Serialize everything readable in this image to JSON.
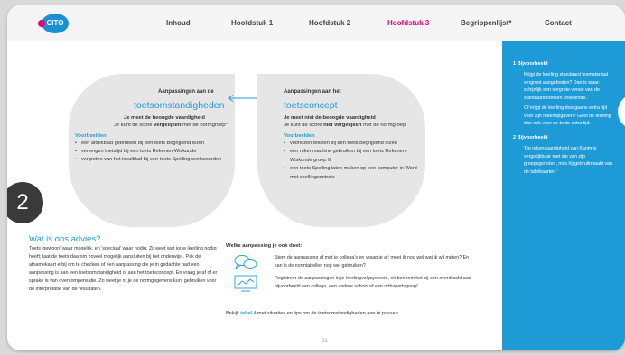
{
  "nav": {
    "logo": "CITO",
    "items": [
      "Inhoud",
      "Hoofdstuk 1",
      "Hoofdstuk 2",
      "Hoofdstuk 3",
      "Begrippenlijst*",
      "Contact"
    ],
    "active": "Hoofdstuk 3",
    "colors": {
      "active": "#e6007e",
      "accent": "#1e9bd7"
    }
  },
  "left_blob": {
    "title": "Aanpassingen aan de",
    "big": "toetsomstandigheden",
    "bold": "Je meet de beoogde vaardigheid",
    "norm_pre": "Je kunt de score ",
    "norm_bold": "vergelijken",
    "norm_post": " met de normgroep*",
    "examples_title": "Voorbeelden",
    "examples": [
      "een afdekblad gebruiken bij een toets Begrijpend lezen",
      "verlengen toetstijd bij een toets Rekenen-Wiskunde",
      "vergroten van het invulblad bij een toets Spelling werkwoorden"
    ]
  },
  "right_blob": {
    "title": "Aanpassingen aan het",
    "big": "toetsconcept",
    "bold": "Je meet niet de beoogde vaardigheid",
    "norm_pre": "Je kunt de score ",
    "norm_bold": "niet vergelijken",
    "norm_post": " met de normgroep",
    "examples_title": "Voorbeelden",
    "examples": [
      "voorlezen teksten bij een toets Begrijpend lezen",
      "een rekenmachine gebruiken bij een toets Rekenen-Wiskunde groep 6",
      "een toets Spelling laten maken op een computer in Word met spellingcontrole"
    ]
  },
  "section_number": "2",
  "advice": {
    "title": "Wat is ons advies?",
    "text": "Toets 'gewoon' waar mogelijk, en 'speciaal' waar nodig. Zij weet wat jouw leerling nodig heeft; laat de toets daarom zoveel mogelijk aansluiten bij het onderwijs¹. Pak de afnamekaart erbij om te checken of een aanpassing die je in gedachte had een aanpassing is aan een toetsomstandigheid of aan het toetsconcept. En vraag je af of er sprake is van overcompensatie. Zo weet je of je de normgegevens kunt gebruiken voor de interpretatie van de resultaten."
  },
  "what_to_do": {
    "title": "Welke aanpassing je ook doet:",
    "items": [
      {
        "icon": "chat-bubbles-icon",
        "text": "Stem de aanpassing af met je collega's en vraag je af: meet ik nog wel wat ik wil meten? En kan ik de normtabellen nog wel gebruiken?"
      },
      {
        "icon": "computer-screen-icon",
        "text": "Registreer de aanpassingen in je leerlingvolgsysteem, en benoem het bij een overdracht aan bijvoorbeeld een collega, een andere school of een orthopedagoog²."
      }
    ],
    "bekijk_pre": "Bekijk ",
    "bekijk_link": "tabel 4",
    "bekijk_post": " met situaties en tips om de toetsomstandigheden aan te passen."
  },
  "page_number": "21",
  "sidebar": {
    "notes": [
      {
        "num_title": "1  Bijvoorbeeld",
        "paras": [
          "Krijgt de leerling standaard lesmateriaal vergroot aangeboden? Dan is waar-schijnlijk een vergrote versie van de standaard toetsen voldoende.",
          "Of krijgt de leerling doorgaans extra tijd voor zijn rekenopgaven? Geef de leerling dan ook voor de toets extra tijd."
        ]
      },
      {
        "num_title": "2  Bijvoorbeeld",
        "paras": [
          "'De rekenvaardigheid van Karim is vergelijkbaar met die van zijn groepsgenoten, mits hij gebruikmaakt van de tafelkaarten.'"
        ]
      }
    ]
  }
}
